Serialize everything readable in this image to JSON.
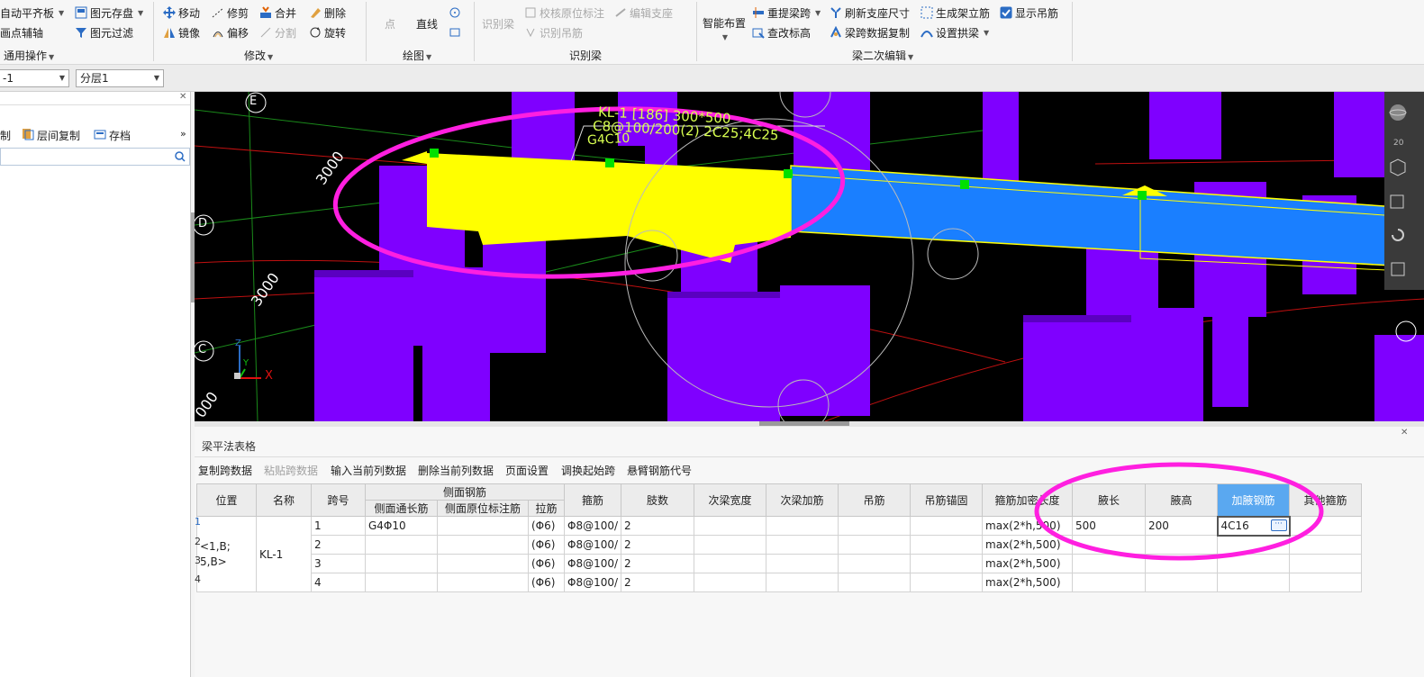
{
  "ribbon": {
    "general": {
      "align_board": "自动平齐板",
      "point_axis": "画点辅轴",
      "save_elem": "图元存盘",
      "filter_elem": "图元过滤",
      "group_label": "通用操作"
    },
    "modify": {
      "move": "移动",
      "trim": "修剪",
      "merge": "合并",
      "delete": "删除",
      "mirror": "镜像",
      "offset": "偏移",
      "split": "分割",
      "rotate": "旋转",
      "group_label": "修改"
    },
    "draw": {
      "point": "点",
      "line": "直线",
      "group_label": "绘图"
    },
    "recognize": {
      "recog_beam": "识别梁",
      "check_annotation": "校核原位标注",
      "edit_support": "编辑支座",
      "recog_hanger": "识别吊筋",
      "group_label": "识别梁"
    },
    "beam_edit": {
      "smart_layout": "智能布置",
      "re_span": "重提梁跨",
      "refresh_support": "刷新支座尺寸",
      "gen_stirrup": "生成架立筋",
      "show_hanger": "显示吊筋",
      "check_elevation": "查改标高",
      "copy_span_data": "梁跨数据复制",
      "set_arch": "设置拱梁",
      "group_label": "梁二次编辑"
    }
  },
  "combos": {
    "floor": "-1",
    "layer": "分层1"
  },
  "leftpanel": {
    "copy": "制",
    "floor_copy": "层间复制",
    "save": "存档",
    "more": "»"
  },
  "viewport": {
    "axis_e": "E",
    "axis_d": "D",
    "axis_c": "C",
    "dim1": "3000",
    "dim2": "3000",
    "dim3": "000",
    "beam_label_1": "KL-1 [186] 300*500",
    "beam_label_2": "C8@100/200(2) 2C25;4C25",
    "beam_label_3": "G4C10",
    "axis_x": "X",
    "axis_y": "Y",
    "axis_z": "Z",
    "cube_label": "20"
  },
  "bottom": {
    "title": "梁平法表格",
    "toolbar": [
      "复制跨数据",
      "粘贴跨数据",
      "输入当前列数据",
      "删除当前列数据",
      "页面设置",
      "调换起始跨",
      "悬臂钢筋代号"
    ],
    "headers": {
      "position": "位置",
      "name": "名称",
      "span": "跨号",
      "side_group": "侧面钢筋",
      "side_through": "侧面通长筋",
      "side_inplace": "侧面原位标注筋",
      "tie": "拉筋",
      "stirrup": "箍筋",
      "legs": "肢数",
      "sec_width": "次梁宽度",
      "sec_add": "次梁加筋",
      "hanger": "吊筋",
      "hanger_anchor": "吊筋锚固",
      "stirrup_add_len": "箍筋加密长度",
      "haunch_len": "腋长",
      "haunch_h": "腋高",
      "haunch_bar": "加腋钢筋",
      "other_stirrup": "其他箍筋"
    },
    "rows": [
      {
        "num": "1",
        "position": "<1,B;",
        "name": "KL-1",
        "span": "1",
        "side_through": "G4Φ10",
        "tie": "(Φ6)",
        "stirrup": "Φ8@100/",
        "legs": "2",
        "add_len": "max(2*h,500)",
        "haunch_len": "500",
        "haunch_h": "200",
        "haunch_bar": "4C16"
      },
      {
        "num": "2",
        "position": "5,B>",
        "name": "",
        "span": "2",
        "side_through": "",
        "tie": "(Φ6)",
        "stirrup": "Φ8@100/",
        "legs": "2",
        "add_len": "max(2*h,500)",
        "haunch_len": "",
        "haunch_h": "",
        "haunch_bar": ""
      },
      {
        "num": "3",
        "position": "",
        "name": "",
        "span": "3",
        "side_through": "",
        "tie": "(Φ6)",
        "stirrup": "Φ8@100/",
        "legs": "2",
        "add_len": "max(2*h,500)",
        "haunch_len": "",
        "haunch_h": "",
        "haunch_bar": ""
      },
      {
        "num": "4",
        "position": "",
        "name": "",
        "span": "4",
        "side_through": "",
        "tie": "(Φ6)",
        "stirrup": "Φ8@100/",
        "legs": "2",
        "add_len": "max(2*h,500)",
        "haunch_len": "",
        "haunch_h": "",
        "haunch_bar": ""
      }
    ]
  },
  "colors": {
    "column": "#7f00ff",
    "selected_beam": "#ffff00",
    "beam": "#1a7fff",
    "highlight_ellipse": "#ff1fe0",
    "grip": "#00e000",
    "header_active": "#5aa8f0"
  }
}
